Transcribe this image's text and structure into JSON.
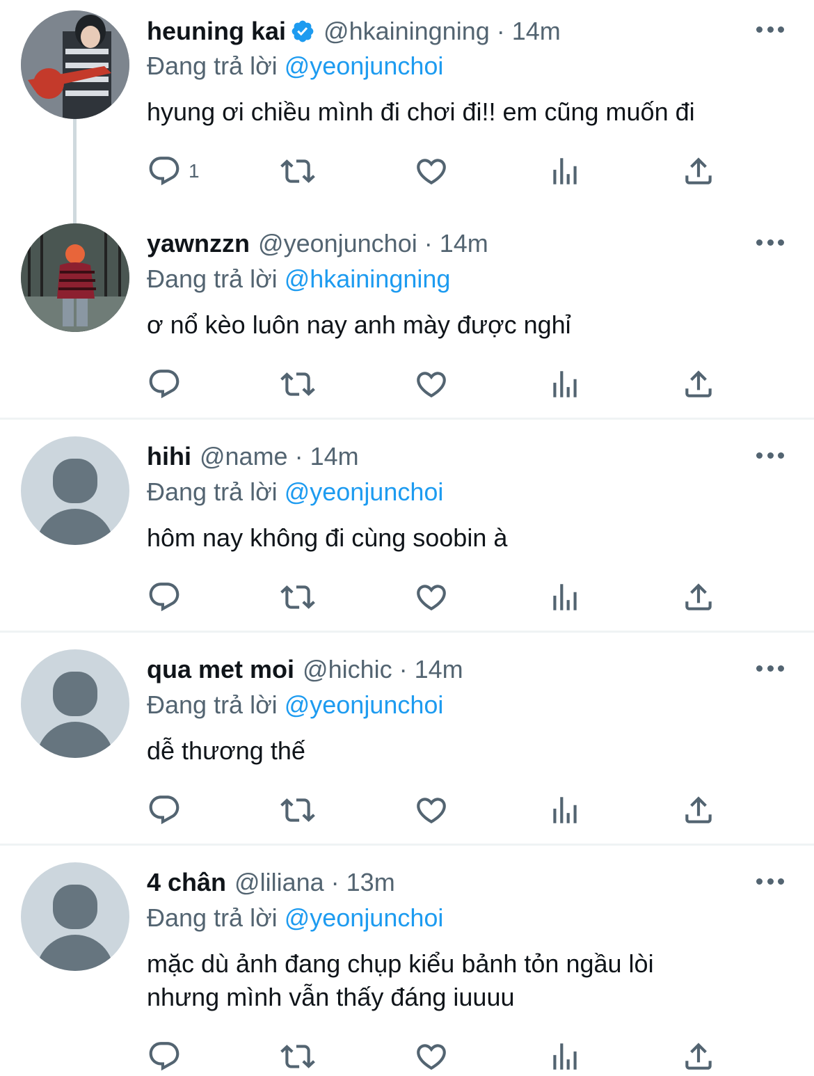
{
  "colors": {
    "link": "#1d9bf0",
    "muted": "#536471",
    "text": "#0f1419",
    "divider": "#eff3f4"
  },
  "tweets": [
    {
      "name": "heuning kai",
      "verified": true,
      "handle": "@hkainingning",
      "dot": "·",
      "time": "14m",
      "reply_prefix": "Đang trả lời",
      "reply_to": "@yeonjunchoi",
      "text": "hyung ơi chiều mình đi chơi đi!! em cũng muốn đi",
      "reply_count": "1",
      "avatar": "photo-avatar"
    },
    {
      "name": "yawnzzn",
      "verified": false,
      "handle": "@yeonjunchoi",
      "dot": "·",
      "time": "14m",
      "reply_prefix": "Đang trả lời",
      "reply_to": "@hkainingning",
      "text": "ơ nổ kèo luôn nay anh mày được nghỉ",
      "reply_count": "",
      "avatar": "photo-avatar"
    },
    {
      "name": "hihi",
      "verified": false,
      "handle": "@name",
      "dot": "·",
      "time": "14m",
      "reply_prefix": "Đang trả lời",
      "reply_to": "@yeonjunchoi",
      "text": "hôm nay không đi cùng soobin à",
      "reply_count": "",
      "avatar": "default-avatar"
    },
    {
      "name": "qua met moi",
      "verified": false,
      "handle": "@hichic",
      "dot": "·",
      "time": "14m",
      "reply_prefix": "Đang trả lời",
      "reply_to": "@yeonjunchoi",
      "text": "dễ thương thế",
      "reply_count": "",
      "avatar": "default-avatar"
    },
    {
      "name": "4 chân",
      "verified": false,
      "handle": "@liliana",
      "dot": "·",
      "time": "13m",
      "reply_prefix": "Đang trả lời",
      "reply_to": "@yeonjunchoi",
      "text_line1": "mặc dù ảnh đang chụp kiểu bảnh tỏn ngầu lòi",
      "text_line2": "nhưng mình vẫn thấy đáng iuuuu",
      "reply_count": "",
      "avatar": "default-avatar"
    }
  ],
  "icons": [
    "reply-icon",
    "retweet-icon",
    "like-icon",
    "analytics-icon",
    "share-icon",
    "more-icon",
    "verified-icon"
  ]
}
